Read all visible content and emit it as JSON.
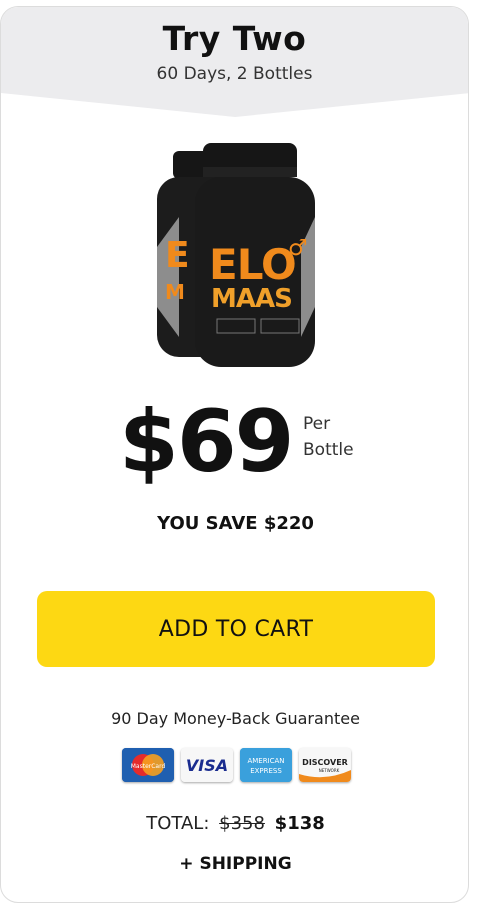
{
  "header": {
    "title": "Try Two",
    "subtitle": "60 Days, 2 Bottles"
  },
  "product": {
    "brand_text": "ELO MAAS",
    "bottle_count": 2
  },
  "pricing": {
    "price": "$69",
    "per_line1": "Per",
    "per_line2": "Bottle",
    "savings": "YOU SAVE $220"
  },
  "cta": {
    "label": "ADD TO CART"
  },
  "guarantee": "90 Day Money-Back Guarantee",
  "payment_methods": [
    "mastercard-icon",
    "visa-icon",
    "amex-icon",
    "discover-icon"
  ],
  "payment_labels": {
    "mastercard": "MasterCard",
    "visa": "VISA",
    "amex_1": "AMERICAN",
    "amex_2": "EXPRESS",
    "discover": "DISCOVER",
    "discover_sub": "NETWORK"
  },
  "total": {
    "label": "TOTAL:",
    "old_price": "$358",
    "new_price": "$138"
  },
  "shipping": "+ SHIPPING",
  "colors": {
    "cta_bg": "#fdd813",
    "header_bg": "#ececee",
    "brand_orange": "#f08a1c"
  }
}
